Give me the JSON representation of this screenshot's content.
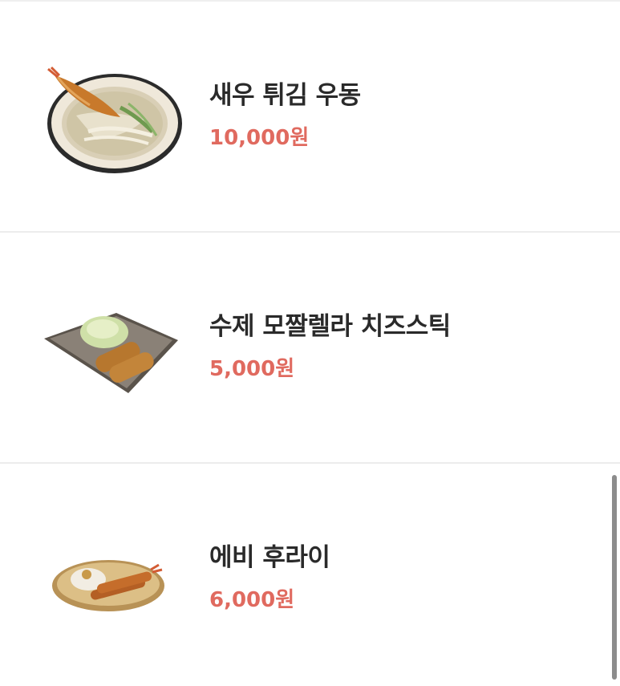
{
  "menu": {
    "items": [
      {
        "name": "새우 튀김 우동",
        "price": "10,000원",
        "image": "shrimp-tempura-udon-image"
      },
      {
        "name": "수제 모짤렐라 치즈스틱",
        "price": "5,000원",
        "image": "mozzarella-cheese-stick-image"
      },
      {
        "name": "에비 후라이",
        "price": "6,000원",
        "image": "ebi-fry-image"
      }
    ]
  },
  "colors": {
    "price": "#e06a5f",
    "name": "#2a2a2a",
    "divider": "#ececec",
    "scrollbar": "#8c8c8c"
  }
}
